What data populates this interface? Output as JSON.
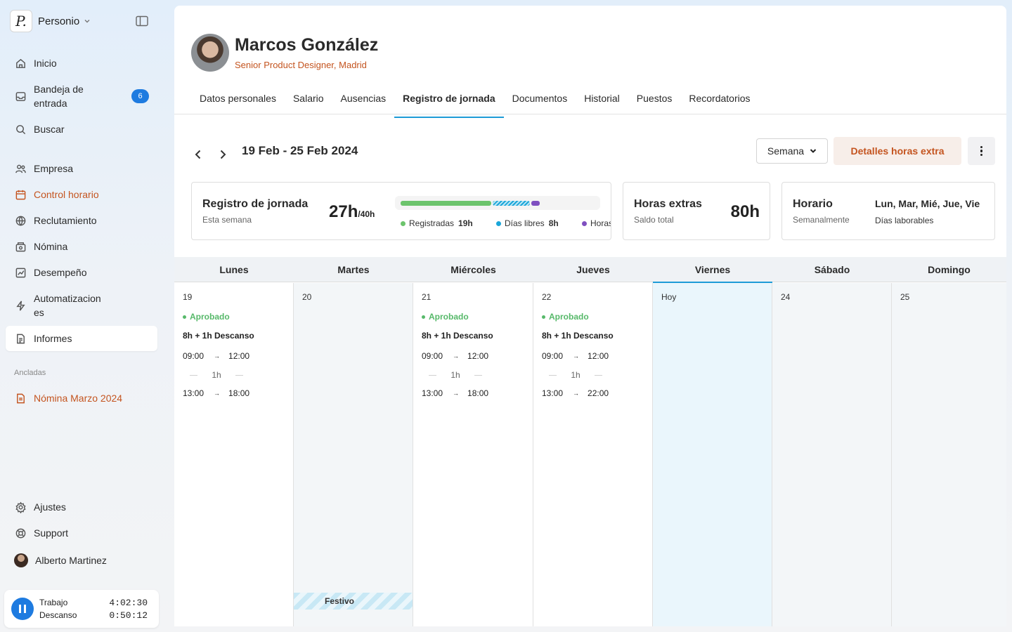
{
  "app": {
    "name": "Personio",
    "logo_letter": "P."
  },
  "nav": {
    "inicio": "Inicio",
    "bandeja": "Bandeja de entrada",
    "bandeja_badge": "6",
    "buscar": "Buscar",
    "empresa": "Empresa",
    "control_horario": "Control horario",
    "reclutamiento": "Reclutamiento",
    "nomina": "Nómina",
    "desempeno": "Desempeño",
    "automatizaciones": "Automatizaciones",
    "informes": "Informes"
  },
  "pinned": {
    "label": "Ancladas",
    "item": "Nómina Marzo 2024"
  },
  "bottom_nav": {
    "ajustes": "Ajustes",
    "support": "Support",
    "user": "Alberto Martinez"
  },
  "timer": {
    "work_label": "Trabajo",
    "work_time": "4:02:30",
    "break_label": "Descanso",
    "break_time": "0:50:12"
  },
  "profile": {
    "name": "Marcos González",
    "role": "Senior Product Designer, Madrid"
  },
  "tabs": [
    "Datos personales",
    "Salario",
    "Ausencias",
    "Registro de jornada",
    "Documentos",
    "Historial",
    "Puestos",
    "Recordatorios"
  ],
  "toolbar": {
    "range": "19 Feb - 25 Feb 2024",
    "view": "Semana",
    "overtime_button": "Detalles horas extra"
  },
  "summary": {
    "title": "Registro de jornada",
    "subtitle": "Esta semana",
    "total": "27h",
    "target": "/40h",
    "progress": {
      "registered_h": 19,
      "days_off_h": 8,
      "overtime_h": 1,
      "capacity_h": 40
    },
    "legend": [
      {
        "label": "Registradas",
        "value": "19h",
        "color": "#6cc46c"
      },
      {
        "label": "Días libres",
        "value": "8h",
        "color": "#1aa6d9"
      },
      {
        "label": "Horas ex",
        "value": "",
        "color": "#7f4fc0"
      }
    ]
  },
  "overtime": {
    "title": "Horas extras",
    "subtitle": "Saldo total",
    "value": "80h"
  },
  "schedule": {
    "title": "Horario",
    "subtitle": "Semanalmente",
    "days": "Lun, Mar, Mié, Jue, Vie",
    "days_label": "Días laborables"
  },
  "calendar": {
    "headers": [
      "Lunes",
      "Martes",
      "Miércoles",
      "Jueves",
      "Viernes",
      "Sábado",
      "Domingo"
    ],
    "days": [
      {
        "num": "19",
        "status": "Aprobado",
        "shift": "8h + 1h Descanso",
        "start1": "09:00",
        "end1": "12:00",
        "break": "1h",
        "start2": "13:00",
        "end2": "18:00"
      },
      {
        "num": "20",
        "festivo": "Festivo"
      },
      {
        "num": "21",
        "status": "Aprobado",
        "shift": "8h + 1h Descanso",
        "start1": "09:00",
        "end1": "12:00",
        "break": "1h",
        "start2": "13:00",
        "end2": "18:00"
      },
      {
        "num": "22",
        "status": "Aprobado",
        "shift": "8h + 1h Descanso",
        "start1": "09:00",
        "end1": "12:00",
        "break": "1h",
        "start2": "13:00",
        "end2": "22:00"
      },
      {
        "num": "Hoy"
      },
      {
        "num": "24"
      },
      {
        "num": "25"
      }
    ],
    "arrow": "→"
  },
  "colors": {
    "accent": "#c4541f",
    "blue": "#1e7be0",
    "approved": "#57b96a",
    "today": "#1e9bd7"
  }
}
